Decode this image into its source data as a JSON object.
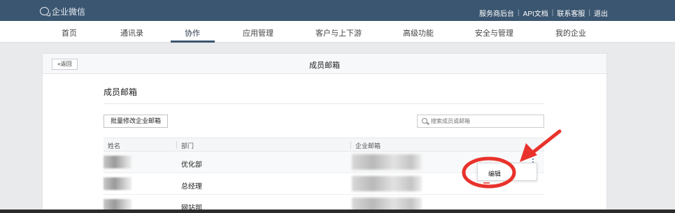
{
  "header": {
    "logo_text": "企业微信",
    "links": [
      "服务商后台",
      "API文档",
      "联系客服",
      "退出"
    ]
  },
  "nav": {
    "items": [
      "首页",
      "通讯录",
      "协作",
      "应用管理",
      "客户与上下游",
      "高级功能",
      "安全与管理",
      "我的企业"
    ],
    "active": "协作"
  },
  "panel": {
    "back_label": "«返回",
    "title": "成员邮箱",
    "section_title": "成员邮箱",
    "batch_button": "批量修改企业邮箱",
    "search_placeholder": "搜索成员或邮箱"
  },
  "table": {
    "columns": [
      "姓名",
      "部门",
      "企业邮箱"
    ],
    "rows": [
      {
        "department": "优化部"
      },
      {
        "department": "总经理"
      },
      {
        "department": "网站部"
      }
    ]
  },
  "popup": {
    "edit_label": "编辑"
  },
  "colors": {
    "topbar": "#3b5670",
    "annotation_red": "#e8322b"
  }
}
